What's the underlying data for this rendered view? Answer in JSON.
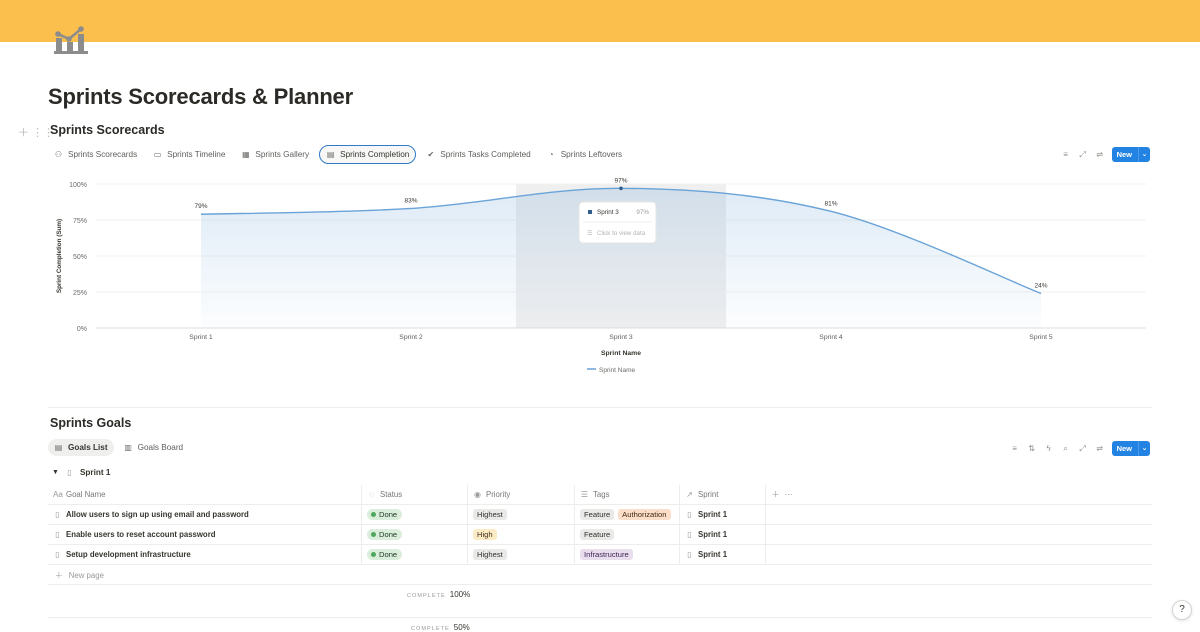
{
  "colors": {
    "cover": "#fbbf4e",
    "accent": "#2383e2",
    "line": "#6aa3d8",
    "done": "#dbeddb"
  },
  "page": {
    "title": "Sprints Scorecards & Planner",
    "icon": "chart-icon"
  },
  "scorecards": {
    "title": "Sprints Scorecards",
    "tabs": [
      {
        "label": "Sprints Scorecards",
        "icon": "scorecard-icon"
      },
      {
        "label": "Sprints Timeline",
        "icon": "timeline-icon"
      },
      {
        "label": "Sprints Gallery",
        "icon": "gallery-icon"
      },
      {
        "label": "Sprints Completion",
        "icon": "chart-icon",
        "active": true
      },
      {
        "label": "Sprints Tasks Completed",
        "icon": "check-circle-icon"
      },
      {
        "label": "Sprints Leftovers",
        "icon": "clock-icon"
      }
    ],
    "new_label": "New"
  },
  "chart_data": {
    "type": "area",
    "categories": [
      "Sprint 1",
      "Sprint 2",
      "Sprint 3",
      "Sprint 4",
      "Sprint 5"
    ],
    "values": [
      79,
      83,
      97,
      81,
      24
    ],
    "value_labels": [
      "79%",
      "83%",
      "97%",
      "81%",
      "24%"
    ],
    "xlabel": "Sprint Name",
    "ylabel": "Sprint Completion (Sum)",
    "ylim": [
      0,
      100
    ],
    "yticks": [
      "0%",
      "25%",
      "50%",
      "75%",
      "100%"
    ],
    "grid": true,
    "legend": {
      "placement": "bottom",
      "label": "Sprint Name"
    },
    "highlight_category": "Sprint 3",
    "tooltip": {
      "name": "Sprint 3",
      "value": "97%",
      "action": "Click to view data"
    }
  },
  "goals": {
    "title": "Sprints Goals",
    "tabs": [
      {
        "label": "Goals List",
        "icon": "list-icon",
        "active": true
      },
      {
        "label": "Goals Board",
        "icon": "board-icon"
      }
    ],
    "new_label": "New",
    "group": "Sprint 1",
    "columns": [
      {
        "label": "Goal Name",
        "icon": "Aa"
      },
      {
        "label": "Status",
        "icon": "◌"
      },
      {
        "label": "Priority",
        "icon": "◉"
      },
      {
        "label": "Tags",
        "icon": "☰"
      },
      {
        "label": "Sprint",
        "icon": "↗"
      }
    ],
    "rows": [
      {
        "name": "Allow users to sign up using email and password",
        "status": "Done",
        "priority": "Highest",
        "tags": [
          "Feature",
          "Authorization"
        ],
        "sprint": "Sprint 1"
      },
      {
        "name": "Enable users to reset account password",
        "status": "Done",
        "priority": "High",
        "tags": [
          "Feature"
        ],
        "sprint": "Sprint 1"
      },
      {
        "name": "Setup development infrastructure",
        "status": "Done",
        "priority": "Highest",
        "tags": [
          "Infrastructure"
        ],
        "sprint": "Sprint 1"
      }
    ],
    "new_page": "New page",
    "calc": [
      {
        "key": "COMPLETE",
        "value": "100%"
      },
      {
        "key": "COMPLETE",
        "value": "50%"
      }
    ]
  },
  "help_label": "?"
}
